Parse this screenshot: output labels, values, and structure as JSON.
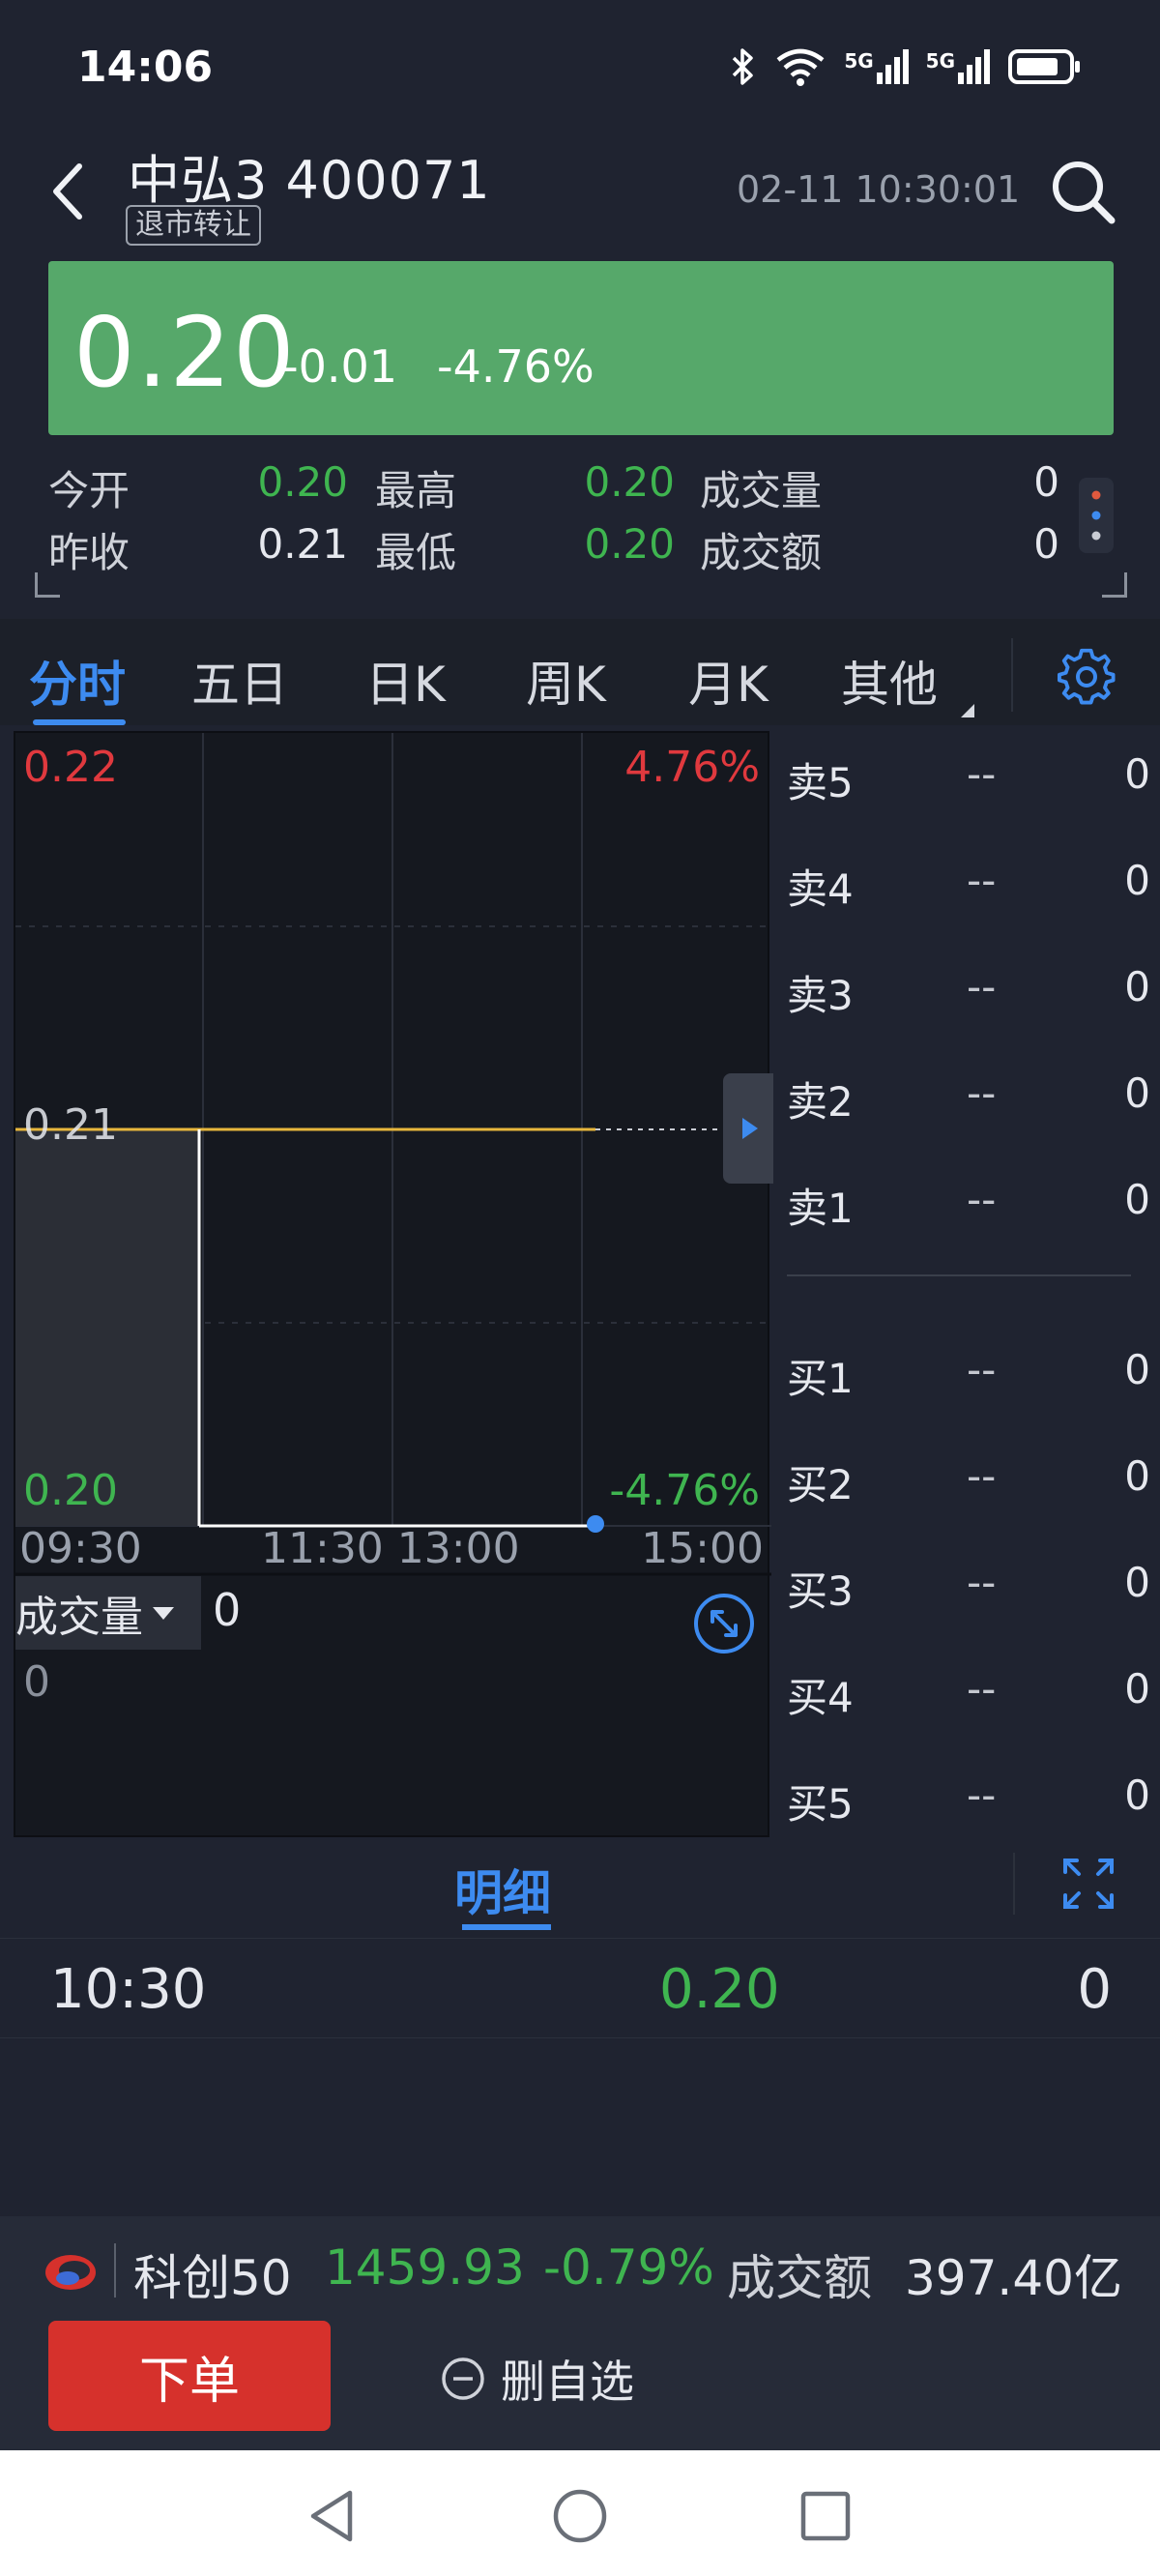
{
  "status_bar": {
    "time": "14:06",
    "icons": [
      "bluetooth-icon",
      "wifi-icon",
      "signal-5g-icon",
      "signal-5g-icon",
      "battery-icon"
    ],
    "net_label_1": "5G",
    "net_label_2": "5G"
  },
  "header": {
    "stock_name": "中弘3 400071",
    "badge": "退市转让",
    "timestamp": "02-11 10:30:01"
  },
  "price": {
    "last": "0.20",
    "change": "-0.01",
    "change_pct": "-4.76%",
    "bg_color": "#56a86a"
  },
  "summary": {
    "open_label": "今开",
    "open_value": "0.20",
    "high_label": "最高",
    "high_value": "0.20",
    "volume_label": "成交量",
    "volume_value": "0",
    "prev_close_label": "昨收",
    "prev_close_value": "0.21",
    "low_label": "最低",
    "low_value": "0.20",
    "amount_label": "成交额",
    "amount_value": "0"
  },
  "tabs": [
    {
      "label": "分时",
      "active": true
    },
    {
      "label": "五日",
      "active": false
    },
    {
      "label": "日K",
      "active": false
    },
    {
      "label": "周K",
      "active": false
    },
    {
      "label": "月K",
      "active": false
    },
    {
      "label": "其他",
      "active": false
    }
  ],
  "chart": {
    "price_top": "0.22",
    "pct_top": "4.76%",
    "price_mid": "0.21",
    "price_bottom": "0.20",
    "pct_bottom": "-4.76%",
    "time_labels": [
      "09:30",
      "11:30 13:00",
      "15:00"
    ],
    "volume_label": "成交量",
    "volume_value": "0",
    "volume_axis": "0",
    "colors": {
      "avg_line": "#e8b73c",
      "price_line": "#ffffff",
      "up": "#e0393e",
      "down": "#3fb550"
    }
  },
  "chart_data": {
    "type": "line",
    "x": [
      "09:30",
      "10:30"
    ],
    "y": [
      0.21,
      0.2
    ],
    "ylim": [
      0.2,
      0.22
    ],
    "reference_price": 0.21
  },
  "orderbook": {
    "asks": [
      {
        "label": "卖5",
        "price": "--",
        "volume": "0"
      },
      {
        "label": "卖4",
        "price": "--",
        "volume": "0"
      },
      {
        "label": "卖3",
        "price": "--",
        "volume": "0"
      },
      {
        "label": "卖2",
        "price": "--",
        "volume": "0"
      },
      {
        "label": "卖1",
        "price": "--",
        "volume": "0"
      }
    ],
    "bids": [
      {
        "label": "买1",
        "price": "--",
        "volume": "0"
      },
      {
        "label": "买2",
        "price": "--",
        "volume": "0"
      },
      {
        "label": "买3",
        "price": "--",
        "volume": "0"
      },
      {
        "label": "买4",
        "price": "--",
        "volume": "0"
      },
      {
        "label": "买5",
        "price": "--",
        "volume": "0"
      }
    ]
  },
  "detail": {
    "title": "明细",
    "rows": [
      {
        "time": "10:30",
        "price": "0.20",
        "volume": "0"
      }
    ]
  },
  "index_bar": {
    "name": "科创50",
    "value": "1459.93",
    "change_pct": "-0.79%",
    "amount_label": "成交额",
    "amount_value": "397.40亿"
  },
  "actions": {
    "order_label": "下单",
    "remove_watch_label": "删自选"
  }
}
